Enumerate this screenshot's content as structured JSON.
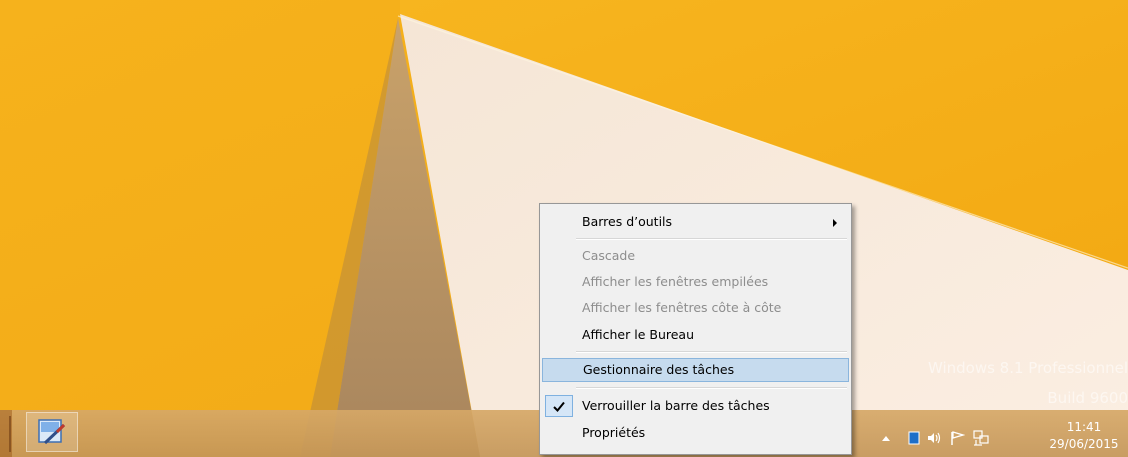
{
  "desktop": {
    "watermark_line1": "Windows 8.1 Professionnel",
    "watermark_line2": "Build 9600",
    "colors": {
      "yellow": "#f5b31a",
      "cream": "#f7e8d8",
      "shadow": "#b59368"
    }
  },
  "context_menu": {
    "items": [
      {
        "label": "Barres d’outils",
        "state": "enabled",
        "has_submenu": true
      },
      {
        "label": "Cascade",
        "state": "disabled"
      },
      {
        "label": "Afficher les fenêtres empilées",
        "state": "disabled"
      },
      {
        "label": "Afficher les fenêtres côte à côte",
        "state": "disabled"
      },
      {
        "label": "Afficher le Bureau",
        "state": "enabled"
      },
      {
        "label": "Gestionnaire des tâches",
        "state": "hovered"
      },
      {
        "label": "Verrouiller la barre des tâches",
        "state": "checked"
      },
      {
        "label": "Propriétés",
        "state": "enabled"
      }
    ],
    "hover_color": "#c6dbee"
  },
  "taskbar": {
    "pinned_app_icon": "paint-brush-icon",
    "tray_icons": [
      "chevron-up-icon",
      "battery-icon",
      "volume-icon",
      "flag-icon",
      "network-icon"
    ],
    "clock": {
      "time": "11:41",
      "date": "29/06/2015"
    }
  }
}
